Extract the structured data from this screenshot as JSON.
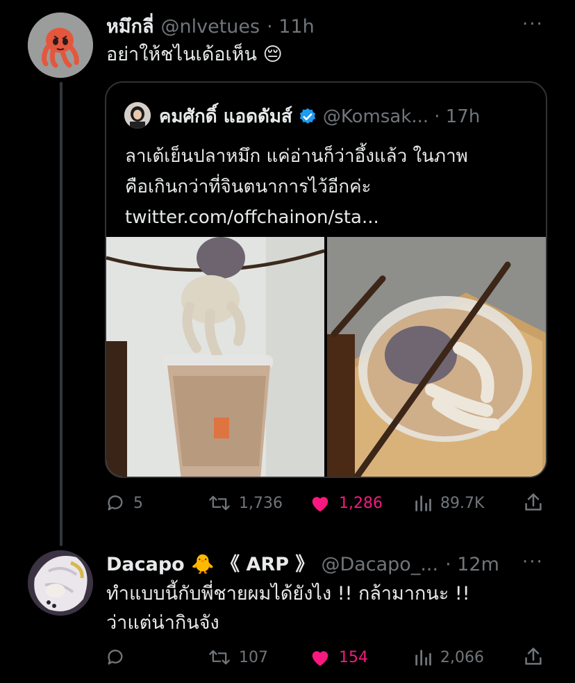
{
  "main_tweet": {
    "display_name": "หมึกลี่",
    "handle": "@nlvetues",
    "time": "· 11h",
    "more": "···",
    "text": "อย่าให้ชไนเด้อเห็น 😔",
    "quote": {
      "display_name": "คมศักดิ์ แอดดัมส์",
      "handle": "@Komsak...",
      "time": "· 17h",
      "text_line1": "ลาเต้เย็นปลาหมึก แค่อ่านก็ว่าอึ้งแล้ว ในภาพ",
      "text_line2": "คือเกินกว่าที่จินตนาการไว้อีกค่ะ",
      "link": "twitter.com/offchainon/sta..."
    },
    "actions": {
      "replies": "5",
      "retweets": "1,736",
      "likes": "1,286",
      "views": "89.7K"
    }
  },
  "reply_tweet": {
    "display_name": "Dacapo 🐥 《 ARP 》",
    "handle": "@Dacapo_...",
    "time": "· 12m",
    "more": "···",
    "text_line1": "ทำแบบนี้กับพี่ชายผมได้ยังไง !! กล้ามากนะ !!",
    "text_line2": "ว่าแต่น่ากินจัง",
    "actions": {
      "replies": "",
      "retweets": "107",
      "likes": "154",
      "views": "2,066"
    }
  },
  "colors": {
    "background": "#000000",
    "text": "#e7e9ea",
    "muted": "#71767b",
    "like": "#f91880",
    "verified": "#1d9bf0",
    "border": "#2f3336"
  },
  "icons": [
    "reply-icon",
    "retweet-icon",
    "heart-icon",
    "views-icon",
    "share-icon",
    "verified-icon",
    "more-icon"
  ]
}
